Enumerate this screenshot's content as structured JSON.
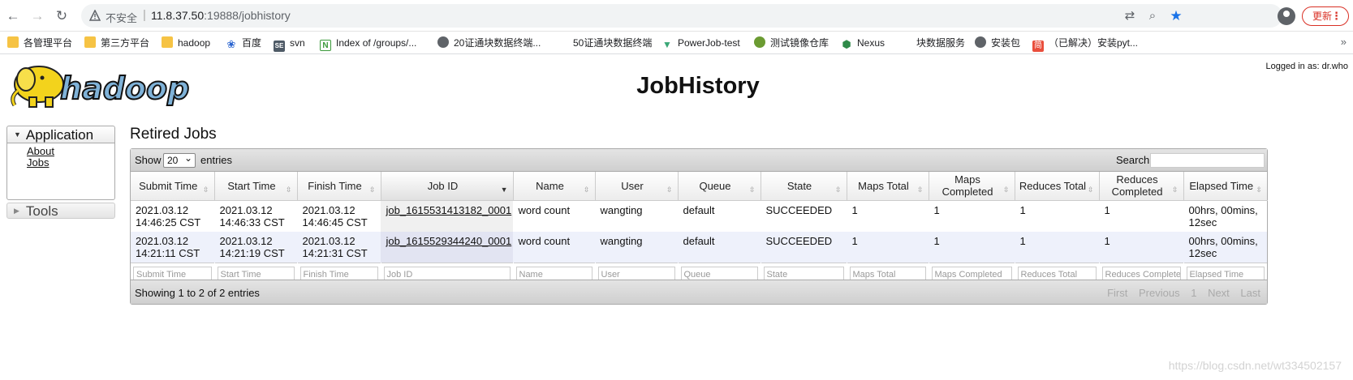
{
  "browser": {
    "security_label": "不安全",
    "url_host": "11.8.37.50",
    "url_rest": ":19888/jobhistory",
    "update_label": "更新"
  },
  "bookmarks": [
    {
      "label": "各管理平台",
      "icon": "folder-icon"
    },
    {
      "label": "第三方平台",
      "icon": "folder-icon"
    },
    {
      "label": "hadoop",
      "icon": "folder-icon"
    },
    {
      "label": "百度",
      "icon": "paw-icon"
    },
    {
      "label": "svn",
      "icon": "svn-icon"
    },
    {
      "label": "Index of /groups/...",
      "icon": "n-icon"
    },
    {
      "label": "20证通块数据终端...",
      "icon": "globe-icon"
    },
    {
      "label": "50证通块数据终端",
      "icon": "none"
    },
    {
      "label": "PowerJob-test",
      "icon": "vue-icon"
    },
    {
      "label": "测试镜像仓库",
      "icon": "mirror-icon"
    },
    {
      "label": "Nexus",
      "icon": "hexagon-icon"
    },
    {
      "label": "块数据服务",
      "icon": "none"
    },
    {
      "label": "安装包",
      "icon": "globe-icon"
    },
    {
      "label": "（已解决）安装pyt...",
      "icon": "jian-icon"
    }
  ],
  "page": {
    "heading": "JobHistory",
    "logged_in": "Logged in as: dr.who",
    "logo_text": "hadoop"
  },
  "sidebar": {
    "application_title": "Application",
    "links": [
      "About",
      "Jobs"
    ],
    "tools_title": "Tools"
  },
  "section_title": "Retired Jobs",
  "table_controls": {
    "show_label": "Show",
    "page_size": "20",
    "entries_label": "entries",
    "search_label": "Search:"
  },
  "columns": [
    "Submit Time",
    "Start Time",
    "Finish Time",
    "Job ID",
    "Name",
    "User",
    "Queue",
    "State",
    "Maps Total",
    "Maps Completed",
    "Reduces Total",
    "Reduces Completed",
    "Elapsed Time"
  ],
  "rows": [
    {
      "submit_time": "2021.03.12 14:46:25 CST",
      "start_time": "2021.03.12 14:46:33 CST",
      "finish_time": "2021.03.12 14:46:45 CST",
      "job_id": "job_1615531413182_0001",
      "name": "word count",
      "user": "wangting",
      "queue": "default",
      "state": "SUCCEEDED",
      "maps_total": "1",
      "maps_completed": "1",
      "reduces_total": "1",
      "reduces_completed": "1",
      "elapsed_time": "00hrs, 00mins, 12sec"
    },
    {
      "submit_time": "2021.03.12 14:21:11 CST",
      "start_time": "2021.03.12 14:21:19 CST",
      "finish_time": "2021.03.12 14:21:31 CST",
      "job_id": "job_1615529344240_0001",
      "name": "word count",
      "user": "wangting",
      "queue": "default",
      "state": "SUCCEEDED",
      "maps_total": "1",
      "maps_completed": "1",
      "reduces_total": "1",
      "reduces_completed": "1",
      "elapsed_time": "00hrs, 00mins, 12sec"
    }
  ],
  "filters": [
    "Submit Time",
    "Start Time",
    "Finish Time",
    "Job ID",
    "Name",
    "User",
    "Queue",
    "State",
    "Maps Total",
    "Maps Completed",
    "Reduces Total",
    "Reduces Complete",
    "Elapsed Time"
  ],
  "footer": {
    "info": "Showing 1 to 2 of 2 entries",
    "first": "First",
    "previous": "Previous",
    "page": "1",
    "next": "Next",
    "last": "Last"
  },
  "watermark": "https://blog.csdn.net/wt334502157",
  "colors": {
    "row_alt": "#eef1fb",
    "header_gradient_end": "#cfcfcf",
    "update_red": "#d93025",
    "star_blue": "#1a73e8"
  }
}
